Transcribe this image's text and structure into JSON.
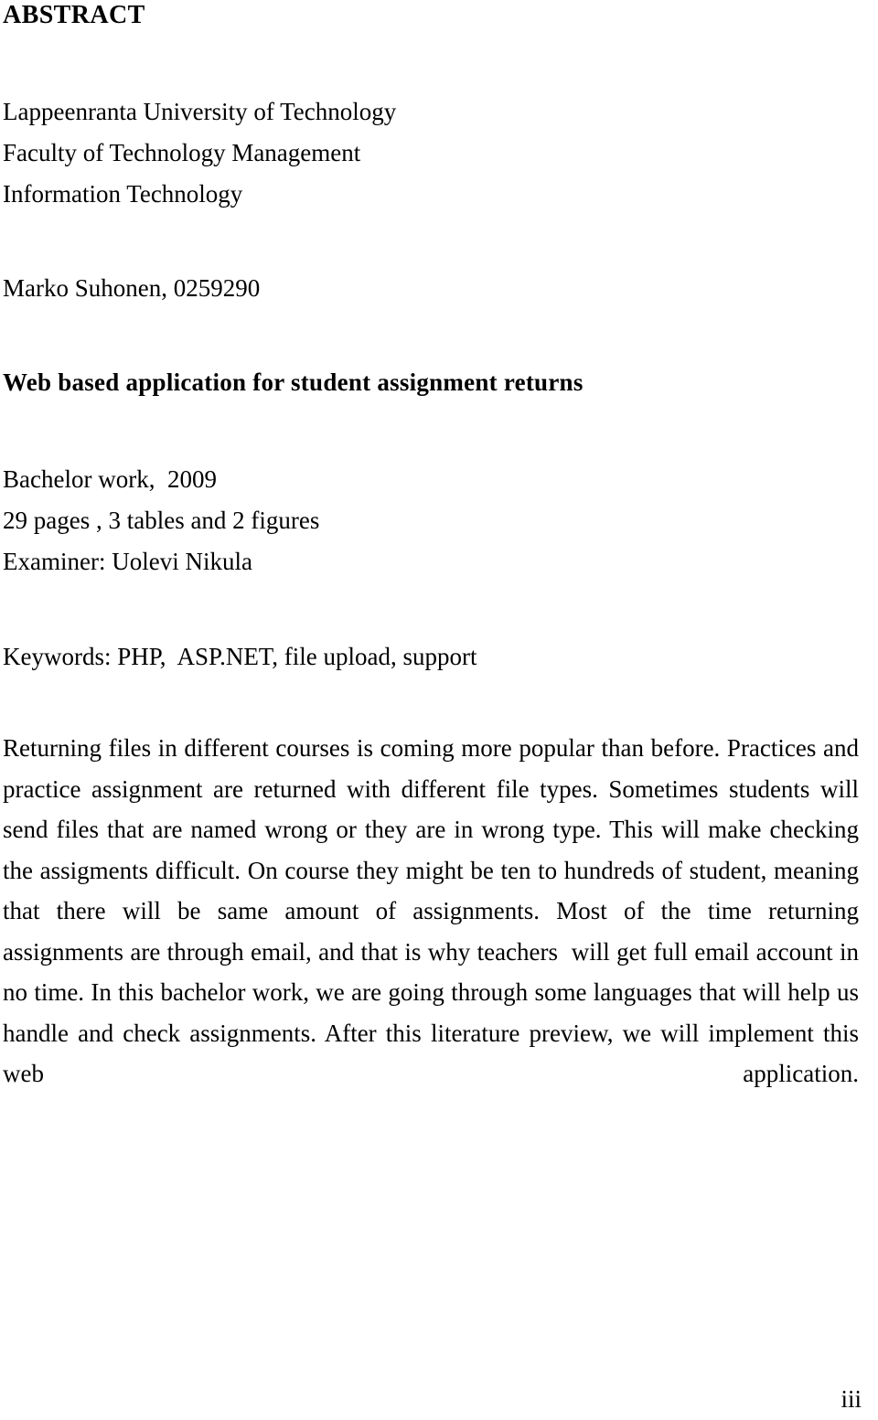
{
  "document": {
    "heading": "ABSTRACT",
    "organization": [
      "Lappeenranta University of Technology",
      "Faculty of Technology Management",
      "Information Technology"
    ],
    "author": "Marko Suhonen, 0259290",
    "work_title": "Web based application for student assignment returns",
    "publication": [
      "Bachelor work,  2009",
      "29 pages , 3 tables and 2 figures",
      "Examiner: Uolevi Nikula"
    ],
    "keywords_line": "Keywords: PHP,  ASP.NET, file upload, support",
    "abstract_body": "Returning files in different courses is coming more popular than before. Practices and practice assignment are returned with different file types. Sometimes students will send files that are named wrong or they are in wrong type. This will make checking the assigments difficult. On course they might be ten to hundreds of student, meaning that there will be same amount of assignments. Most of the time returning assignments are through email, and that is why teachers  will get full email account in no time. In this bachelor work, we are going through some languages that will help us handle and check assignments. After this literature preview, we will implement this web application.",
    "page_number": "iii"
  }
}
